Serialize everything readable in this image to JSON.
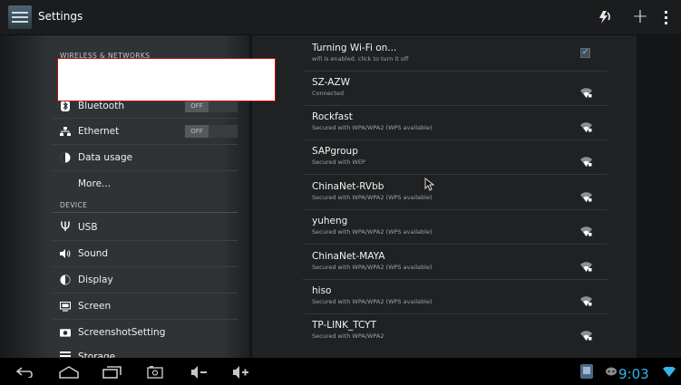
{
  "action_bar": {
    "title": "Settings",
    "icons": {
      "app": "settings-icon",
      "wps": "wps-icon",
      "add": "add-network-icon",
      "overflow": "overflow-menu-icon"
    }
  },
  "sidebar": {
    "categories": [
      "WIRELESS & NETWORKS",
      "DEVICE"
    ],
    "items": [
      {
        "label": "Bluetooth",
        "icon": "bluetooth-icon",
        "toggle": "OFF"
      },
      {
        "label": "Ethernet",
        "icon": "ethernet-icon",
        "toggle": "OFF"
      },
      {
        "label": "Data usage",
        "icon": "data-usage-icon"
      },
      {
        "label": "More..."
      },
      {
        "label": "USB",
        "icon": "usb-icon"
      },
      {
        "label": "Sound",
        "icon": "sound-icon"
      },
      {
        "label": "Display",
        "icon": "display-icon"
      },
      {
        "label": "Screen",
        "icon": "screen-icon"
      },
      {
        "label": "ScreenshotSetting",
        "icon": "camera-icon"
      },
      {
        "label": "Storage",
        "icon": "storage-icon"
      }
    ]
  },
  "wifi": {
    "header": {
      "title": "Turning Wi-Fi on...",
      "summary": "wifi is enabled. click to turn it off",
      "checked": true
    },
    "networks": [
      {
        "ssid": "SZ-AZW",
        "summary": "Connected"
      },
      {
        "ssid": "Rockfast",
        "summary": "Secured with WPA/WPA2 (WPS available)"
      },
      {
        "ssid": "SAPgroup",
        "summary": "Secured with WEP"
      },
      {
        "ssid": "ChinaNet-RVbb",
        "summary": "Secured with WPA/WPA2 (WPS available)"
      },
      {
        "ssid": "yuheng",
        "summary": "Secured with WPA/WPA2 (WPS available)"
      },
      {
        "ssid": "ChinaNet-MAYA",
        "summary": "Secured with WPA/WPA2 (WPS available)"
      },
      {
        "ssid": "hiso",
        "summary": "Secured with WPA/WPA2 (WPS available)"
      },
      {
        "ssid": "TP-LINK_TCYT",
        "summary": "Secured with WPA/WPA2"
      }
    ]
  },
  "status_bar": {
    "time": "9:03"
  },
  "colors": {
    "accent": "#33b5e5",
    "annotation_border": "#c40c0c"
  }
}
